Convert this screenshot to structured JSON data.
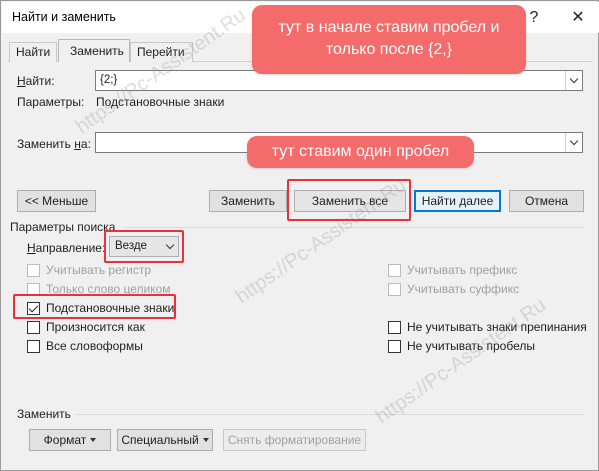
{
  "window": {
    "title": "Найти и заменить",
    "help_label": "?",
    "close_label": "✕"
  },
  "tabs": [
    {
      "label": "Найти",
      "active": false
    },
    {
      "label": "Заменить",
      "active": true
    },
    {
      "label": "Перейти",
      "active": false
    }
  ],
  "find": {
    "label": "Найти:",
    "value": "{2;}",
    "options_label": "Параметры:",
    "options_value": "Подстановочные знаки"
  },
  "replace": {
    "label": "Заменить на:",
    "value": ""
  },
  "buttons": {
    "less": "<< Меньше",
    "replace": "Заменить",
    "replace_all": "Заменить все",
    "find_next": "Найти далее",
    "cancel": "Отмена"
  },
  "search_options": {
    "title": "Параметры поиска",
    "direction_label": "Направление:",
    "direction_value": "Везде",
    "left": [
      {
        "label": "Учитывать регистр",
        "checked": false,
        "disabled": true
      },
      {
        "label": "Только слово целиком",
        "checked": false,
        "disabled": true
      },
      {
        "label": "Подстановочные знаки",
        "checked": true,
        "disabled": false
      },
      {
        "label": "Произносится как",
        "checked": false,
        "disabled": false
      },
      {
        "label": "Все словоформы",
        "checked": false,
        "disabled": false
      }
    ],
    "right": [
      {
        "label": "Учитывать префикс",
        "checked": false,
        "disabled": true
      },
      {
        "label": "Учитывать суффикс",
        "checked": false,
        "disabled": true
      },
      {
        "label": "Не учитывать знаки препинания",
        "checked": false,
        "disabled": false
      },
      {
        "label": "Не учитывать пробелы",
        "checked": false,
        "disabled": false
      }
    ]
  },
  "replace_section": {
    "title": "Заменить",
    "format": "Формат",
    "special": "Специальный",
    "clear_format": "Снять форматирование"
  },
  "annotations": {
    "callout_top": "тут в начале ставим пробел и только после {2,}",
    "callout_mid": "тут ставим один пробел",
    "color": "#f36b6b",
    "highlight_color": "#e8313b"
  },
  "watermark": "https://Pc-Assistent.Ru"
}
